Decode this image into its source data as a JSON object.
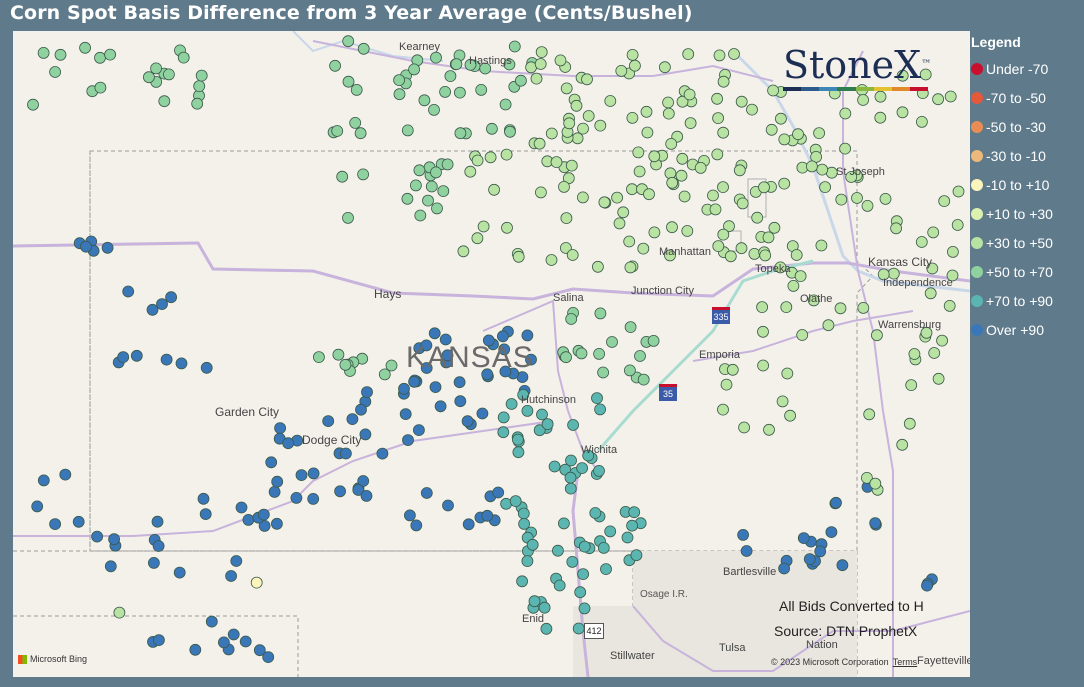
{
  "title": "Corn Spot Basis Difference from 3 Year Average (Cents/Bushel)",
  "legend": {
    "title": "Legend",
    "items": [
      {
        "label": "Under -70",
        "color": "#c8102e"
      },
      {
        "label": "-70 to -50",
        "color": "#e3593a"
      },
      {
        "label": "-50 to -30",
        "color": "#ea8d55"
      },
      {
        "label": "-30 to -10",
        "color": "#edb87c"
      },
      {
        "label": "-10 to +10",
        "color": "#fbf4bd"
      },
      {
        "label": "+10 to +30",
        "color": "#dcf0b0"
      },
      {
        "label": "+30 to +50",
        "color": "#b9e3a2"
      },
      {
        "label": "+50 to +70",
        "color": "#8fd2a0"
      },
      {
        "label": "+70 to +90",
        "color": "#5bb5b1"
      },
      {
        "label": "Over +90",
        "color": "#3a77b8"
      }
    ]
  },
  "logo": {
    "text": "StoneX",
    "trademark": "™",
    "bar_colors": [
      "#1d2e55",
      "#2b5a8c",
      "#3d86b5",
      "#2e7d4f",
      "#8ab73f",
      "#e4c12f",
      "#e08a2a",
      "#c8102e"
    ]
  },
  "places": {
    "kansas": "KANSAS",
    "hays": "Hays",
    "garden_city": "Garden City",
    "dodge_city": "Dodge City",
    "hutchinson": "Hutchinson",
    "wichita": "Wichita",
    "salina": "Salina",
    "junction_city": "Junction City",
    "manhattan": "Manhattan",
    "topeka": "Topeka",
    "kansas_city": "Kansas City",
    "independence": "Independence",
    "olathe": "Olathe",
    "st_joseph": "St Joseph",
    "emporia": "Emporia",
    "warrensburg": "Warrensburg",
    "hastings": "Hastings",
    "kearney": "Kearney",
    "bartlesville": "Bartlesville",
    "osage": "Osage I.R.",
    "enid": "Enid",
    "stillwater": "Stillwater",
    "tulsa": "Tulsa",
    "nation": "Nation",
    "fayetteville": "Fayetteville"
  },
  "highways": {
    "i335": "335",
    "i35": "35",
    "us412": "412"
  },
  "notes": {
    "converted": "All Bids Converted to H",
    "source": "Source: DTN ProphetX"
  },
  "attribution": {
    "bing": "Microsoft Bing",
    "copyright": "© 2023 Microsoft Corporation",
    "terms": "Terms"
  },
  "map_data": {
    "category_colors": [
      "#c8102e",
      "#e3593a",
      "#ea8d55",
      "#edb87c",
      "#fbf4bd",
      "#dcf0b0",
      "#b9e3a2",
      "#8fd2a0",
      "#5bb5b1",
      "#3a77b8"
    ],
    "points": []
  }
}
